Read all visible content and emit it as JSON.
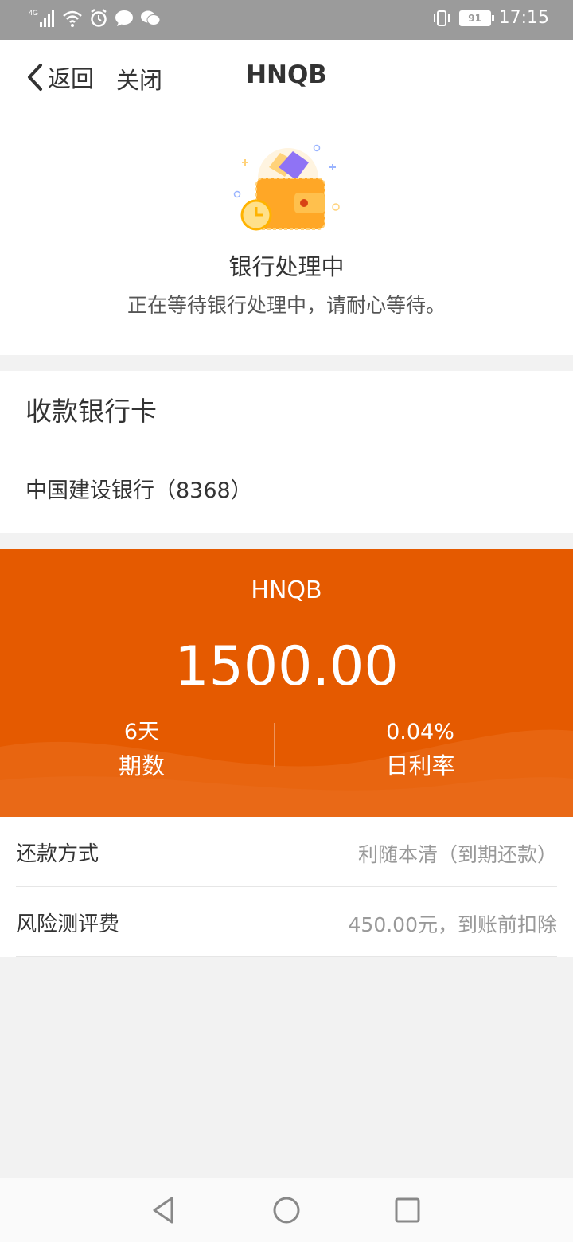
{
  "status_bar": {
    "network": "4G",
    "battery": "91",
    "time": "17:15"
  },
  "header": {
    "back_label": "返回",
    "close_label": "关闭",
    "title": "HNQB"
  },
  "status": {
    "title": "银行处理中",
    "description": "正在等待银行处理中，请耐心等待。"
  },
  "bank_card": {
    "heading": "收款银行卡",
    "name": "中国建设银行（8368）"
  },
  "loan": {
    "name": "HNQB",
    "amount": "1500.00",
    "term_value": "6天",
    "term_label": "期数",
    "rate_value": "0.04%",
    "rate_label": "日利率"
  },
  "details": [
    {
      "label": "还款方式",
      "value": "利随本清（到期还款）"
    },
    {
      "label": "风险测评费",
      "value": "450.00元，到账前扣除"
    }
  ],
  "colors": {
    "accent": "#e55a00",
    "status_bar": "#9b9b9b",
    "background": "#f2f2f2"
  },
  "icons": [
    "signal-icon",
    "wifi-icon",
    "alarm-icon",
    "chat-icon",
    "wechat-icon",
    "vibrate-icon",
    "battery-icon",
    "back-arrow-icon",
    "wallet-illustration",
    "nav-back-icon",
    "nav-home-icon",
    "nav-recent-icon"
  ]
}
